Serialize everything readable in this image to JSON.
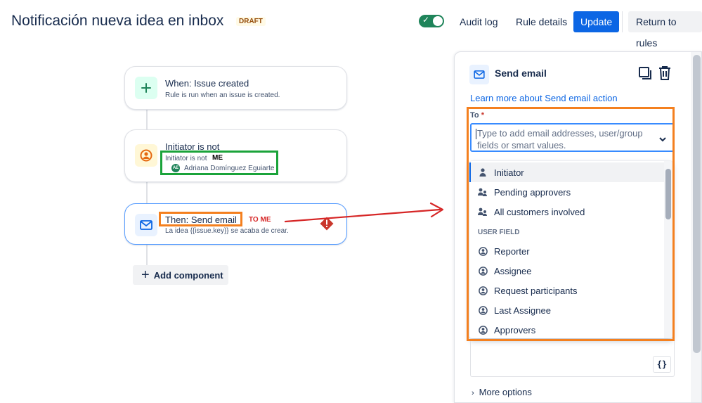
{
  "header": {
    "title": "Notificación nueva idea en inbox",
    "status_badge": "DRAFT",
    "toggle_enabled": true,
    "audit_log": "Audit log",
    "rule_details": "Rule details",
    "update": "Update",
    "return_to_rules": "Return to rules"
  },
  "flow": {
    "trigger": {
      "title": "When: Issue created",
      "subtitle": "Rule is run when an issue is created.",
      "icon": "plus-icon"
    },
    "condition": {
      "title": "Initiator is not",
      "subtitle": "Initiator is not",
      "user_initials": "AE",
      "user_name": "Adriana Domínguez Eguiarte",
      "icon": "user-circle-icon"
    },
    "action": {
      "title": "Then: Send email",
      "subtitle": "La idea {{issue.key}} se acaba de crear.",
      "icon": "mail-icon",
      "error_icon": "error-diamond-icon"
    },
    "add_component": "Add component"
  },
  "annotations": {
    "me_label": "ME",
    "to_me_label": "TO ME"
  },
  "panel": {
    "title": "Send email",
    "learn_more": "Learn more about Send email action",
    "to_label": "To",
    "required_marker": "*",
    "to_placeholder": "Type to add email addresses, user/group fields or smart values.",
    "more_options": "More options",
    "smart_values_button": "{}",
    "dropdown": {
      "items": [
        {
          "label": "Initiator",
          "icon": "person-icon",
          "active": true
        },
        {
          "label": "Pending approvers",
          "icon": "people-icon"
        },
        {
          "label": "All customers involved",
          "icon": "people-icon"
        }
      ],
      "group_label": "USER FIELD",
      "user_field_items": [
        {
          "label": "Reporter",
          "icon": "user-circle-icon"
        },
        {
          "label": "Assignee",
          "icon": "user-circle-icon"
        },
        {
          "label": "Request participants",
          "icon": "user-circle-icon"
        },
        {
          "label": "Last Assignee",
          "icon": "user-circle-icon"
        },
        {
          "label": "Approvers",
          "icon": "user-circle-icon"
        }
      ]
    }
  },
  "colors": {
    "primary": "#0c66e4",
    "toggle_on": "#1f845a",
    "annotation_orange": "#f4801f",
    "annotation_green": "#1aa33a",
    "annotation_red": "#d62626",
    "error": "#c9372c"
  }
}
